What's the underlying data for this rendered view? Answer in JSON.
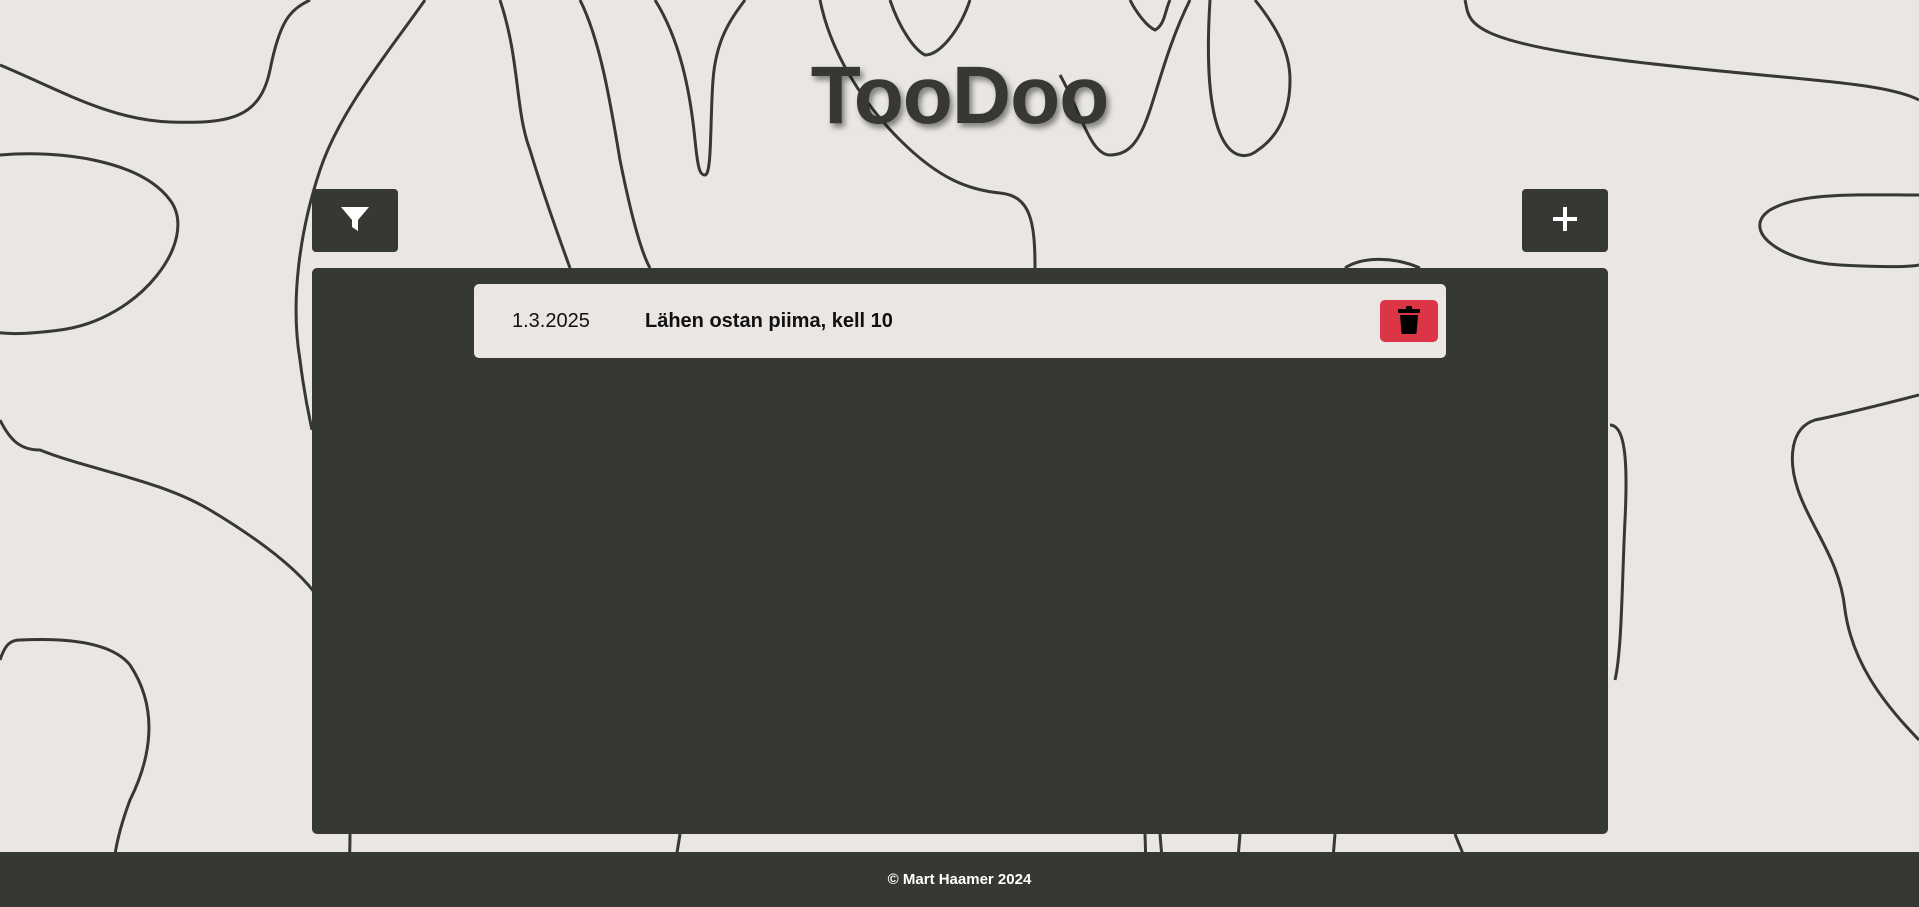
{
  "app": {
    "title": "TooDoo"
  },
  "toolbar": {
    "filter_icon": "filter-icon",
    "add_icon": "plus-icon"
  },
  "todos": [
    {
      "date": "1.3.2025",
      "text": "Lähen ostan piima, kell 10",
      "delete_icon": "trash-icon"
    }
  ],
  "footer": {
    "text": "© Mart Haamer 2024"
  },
  "colors": {
    "background": "#e9e6e3",
    "dark": "#363833",
    "danger": "#dc3545",
    "line": "#363833"
  }
}
